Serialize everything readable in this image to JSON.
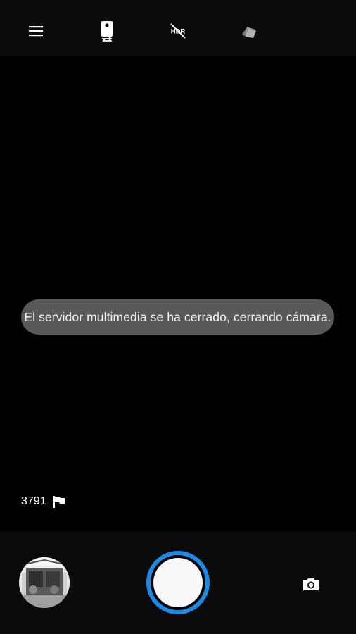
{
  "top_bar": {
    "icons": [
      "menu-icon",
      "camera-mode-icon",
      "hdr-off-icon",
      "photo-style-icon",
      "moon-icon"
    ]
  },
  "toast": {
    "message": "El servidor multimedia se ha cerrado, cerrando cámara."
  },
  "counter": {
    "remaining_photos": "3791",
    "icon": "flag-icon"
  },
  "bottom_bar": {
    "thumbnail_icon": "gallery-thumbnail",
    "shutter_color": "#1e88e5",
    "switch_icon": "camera-icon"
  }
}
